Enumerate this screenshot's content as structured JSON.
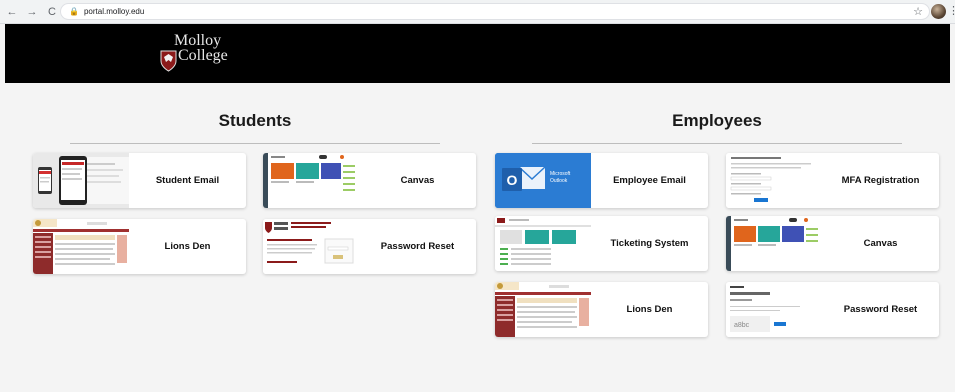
{
  "browser": {
    "url": "portal.molloy.edu",
    "back_icon": "←",
    "forward_icon": "→",
    "reload_icon": "C",
    "lock_icon": "🔒",
    "star_icon": "☆",
    "menu_icon": "⋮"
  },
  "header": {
    "logo_line1": "Molloy",
    "logo_line2": "College",
    "background": "#000000",
    "accent": "#8b1a1a"
  },
  "students": {
    "title": "Students",
    "tiles": [
      {
        "label": "Student Email",
        "thumb": "devices"
      },
      {
        "label": "Canvas",
        "thumb": "canvas"
      },
      {
        "label": "Lions Den",
        "thumb": "lionsden"
      },
      {
        "label": "Password Reset",
        "thumb": "molloyreset"
      }
    ]
  },
  "employees": {
    "title": "Employees",
    "tiles": [
      {
        "label": "Employee Email",
        "thumb": "outlook"
      },
      {
        "label": "MFA Registration",
        "thumb": "mfa"
      },
      {
        "label": "Ticketing System",
        "thumb": "ticketing"
      },
      {
        "label": "Canvas",
        "thumb": "canvas"
      },
      {
        "label": "Lions Den",
        "thumb": "lionsden"
      },
      {
        "label": "Password Reset",
        "thumb": "msreset"
      }
    ],
    "outlook_text_1": "Microsoft",
    "outlook_text_2": "Outlook"
  }
}
